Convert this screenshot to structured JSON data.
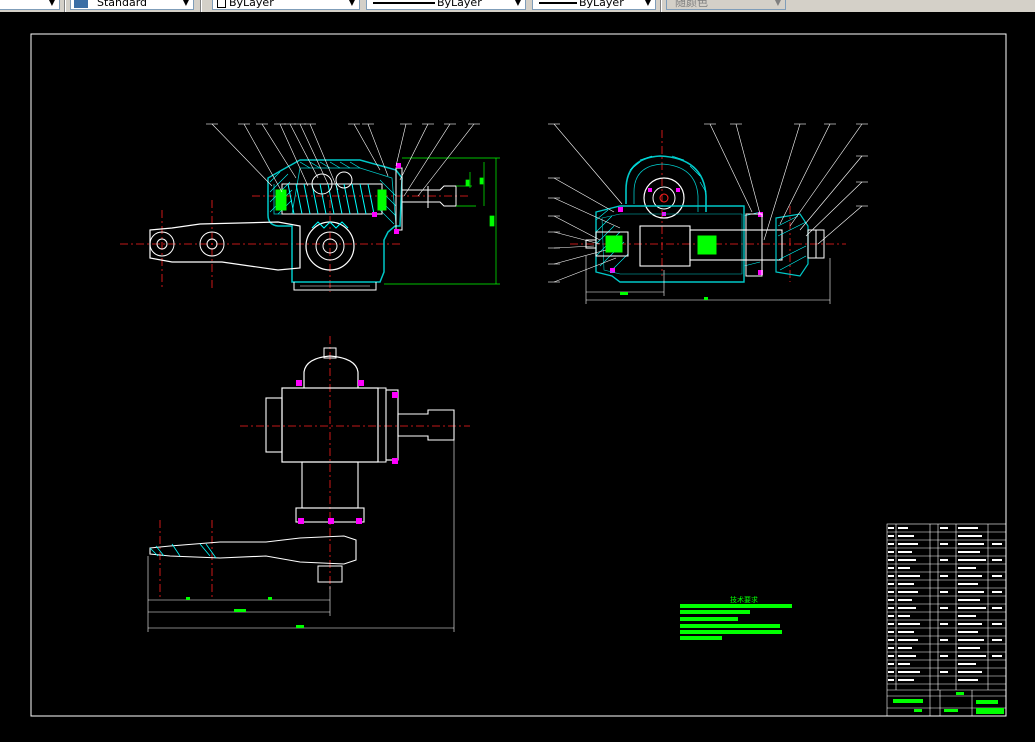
{
  "toolbar": {
    "text_style": "Standard",
    "layer": "ByLayer",
    "linetype": "ByLayer",
    "lineweight": "ByLayer",
    "plot_style": "随颜色"
  },
  "drawing": {
    "title": "技术要求"
  },
  "colors": {
    "background": "#000000",
    "frame": "#ffffff",
    "outline": "#ffffff",
    "section": "#00c8c8",
    "centerline": "#ff2020",
    "dimension": "#00ff00",
    "hatch": "#00ffff",
    "fastener": "#ff00ff",
    "leader": "#ffffff"
  }
}
